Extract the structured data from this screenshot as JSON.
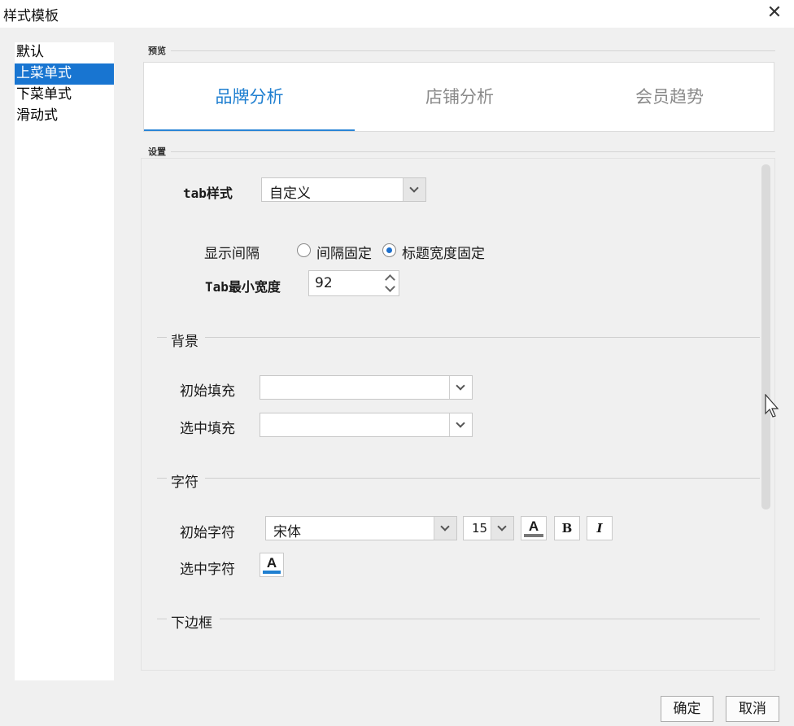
{
  "window": {
    "title": "样式模板",
    "close_icon": "close-icon"
  },
  "sidebar": {
    "items": [
      {
        "label": "默认",
        "selected": false
      },
      {
        "label": "上菜单式",
        "selected": true
      },
      {
        "label": "下菜单式",
        "selected": false
      },
      {
        "label": "滑动式",
        "selected": false
      }
    ]
  },
  "preview": {
    "legend": "预览",
    "tabs": [
      {
        "label": "品牌分析",
        "active": true
      },
      {
        "label": "店铺分析",
        "active": false
      },
      {
        "label": "会员趋势",
        "active": false
      }
    ],
    "active_color": "#1f7fd0"
  },
  "settings": {
    "legend": "设置",
    "tab_style": {
      "label": "tab样式",
      "value": "自定义"
    },
    "display_gap": {
      "label": "显示间隔",
      "options": [
        {
          "label": "间隔固定",
          "checked": false
        },
        {
          "label": "标题宽度固定",
          "checked": true
        }
      ]
    },
    "min_width": {
      "label": "Tab最小宽度",
      "value": "92"
    },
    "background": {
      "section": "背景",
      "initial_fill": {
        "label": "初始填充",
        "value": ""
      },
      "selected_fill": {
        "label": "选中填充",
        "value": ""
      }
    },
    "chars": {
      "section": "字符",
      "initial": {
        "label": "初始字符",
        "font": "宋体",
        "size": "15",
        "color": "#777777",
        "bold": "B",
        "italic": "I",
        "color_glyph": "A"
      },
      "selected": {
        "label": "选中字符",
        "color": "#1f7fd0",
        "color_glyph": "A"
      }
    },
    "bottom_border": {
      "section": "下边框"
    }
  },
  "footer": {
    "ok": "确定",
    "cancel": "取消"
  }
}
